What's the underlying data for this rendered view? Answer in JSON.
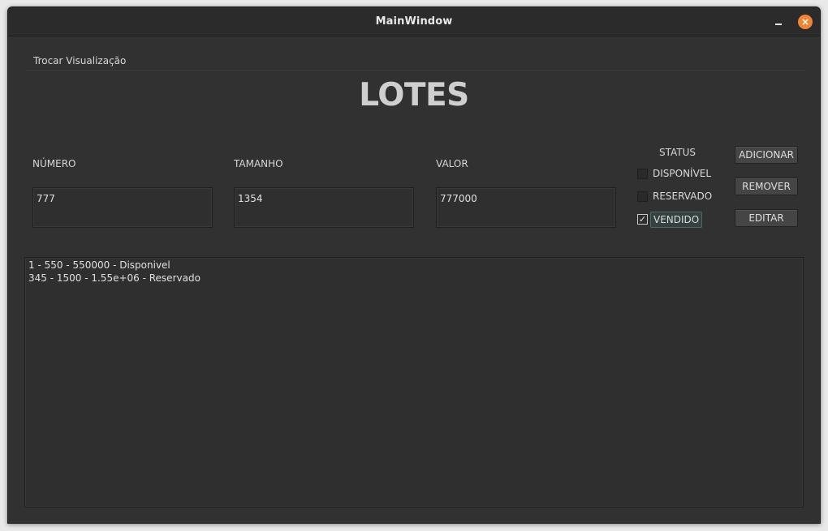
{
  "window": {
    "title": "MainWindow",
    "close_glyph": "×"
  },
  "menu": {
    "items": [
      {
        "label": "Trocar Visualização"
      }
    ]
  },
  "heading": "LOTES",
  "fields": {
    "numero": {
      "label": "NÚMERO",
      "value": "777"
    },
    "tamanho": {
      "label": "TAMANHO",
      "value": "1354"
    },
    "valor": {
      "label": "VALOR",
      "value": "777000"
    }
  },
  "status": {
    "title": "STATUS",
    "options": [
      {
        "label": "DISPONÍVEL",
        "checked": false
      },
      {
        "label": "RESERVADO",
        "checked": false
      },
      {
        "label": "VENDIDO",
        "checked": true
      }
    ],
    "check_glyph": "✓"
  },
  "buttons": {
    "add": "ADICIONAR",
    "remove": "REMOVER",
    "edit": "EDITAR"
  },
  "list": {
    "items": [
      "1 - 550 - 550000 - Disponivel",
      "345 - 1500 - 1.55e+06 - Reservado"
    ]
  },
  "icons": {
    "close": "close-icon",
    "minimize": "minimize-icon",
    "check": "check-icon"
  },
  "colors": {
    "window_bg": "#313131",
    "accent_close": "#f08437",
    "selected_bg": "#354040"
  }
}
